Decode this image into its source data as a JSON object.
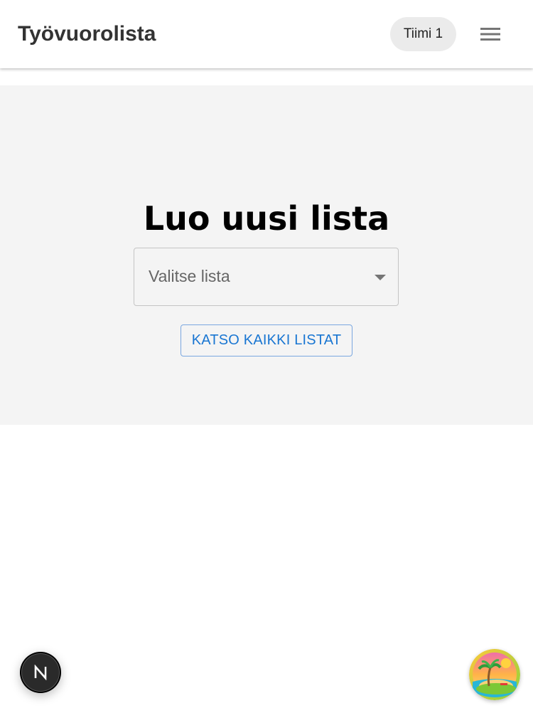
{
  "header": {
    "title": "Työvuorolista",
    "team_chip": "Tiimi 1",
    "menu_icon": "hamburger-menu-icon"
  },
  "main": {
    "heading": "Luo uusi lista",
    "select": {
      "placeholder": "Valitse lista",
      "arrow_icon": "dropdown-arrow-icon"
    },
    "view_all_button": "KATSO KAIKKI LISTAT"
  },
  "floating": {
    "dev_badge_icon": "nextjs-logo-icon",
    "island_badge_icon": "tropical-island-icon"
  },
  "colors": {
    "accent": "#1976d2",
    "hero_background": "#f4f4f4",
    "chip_background": "#ebebeb"
  }
}
